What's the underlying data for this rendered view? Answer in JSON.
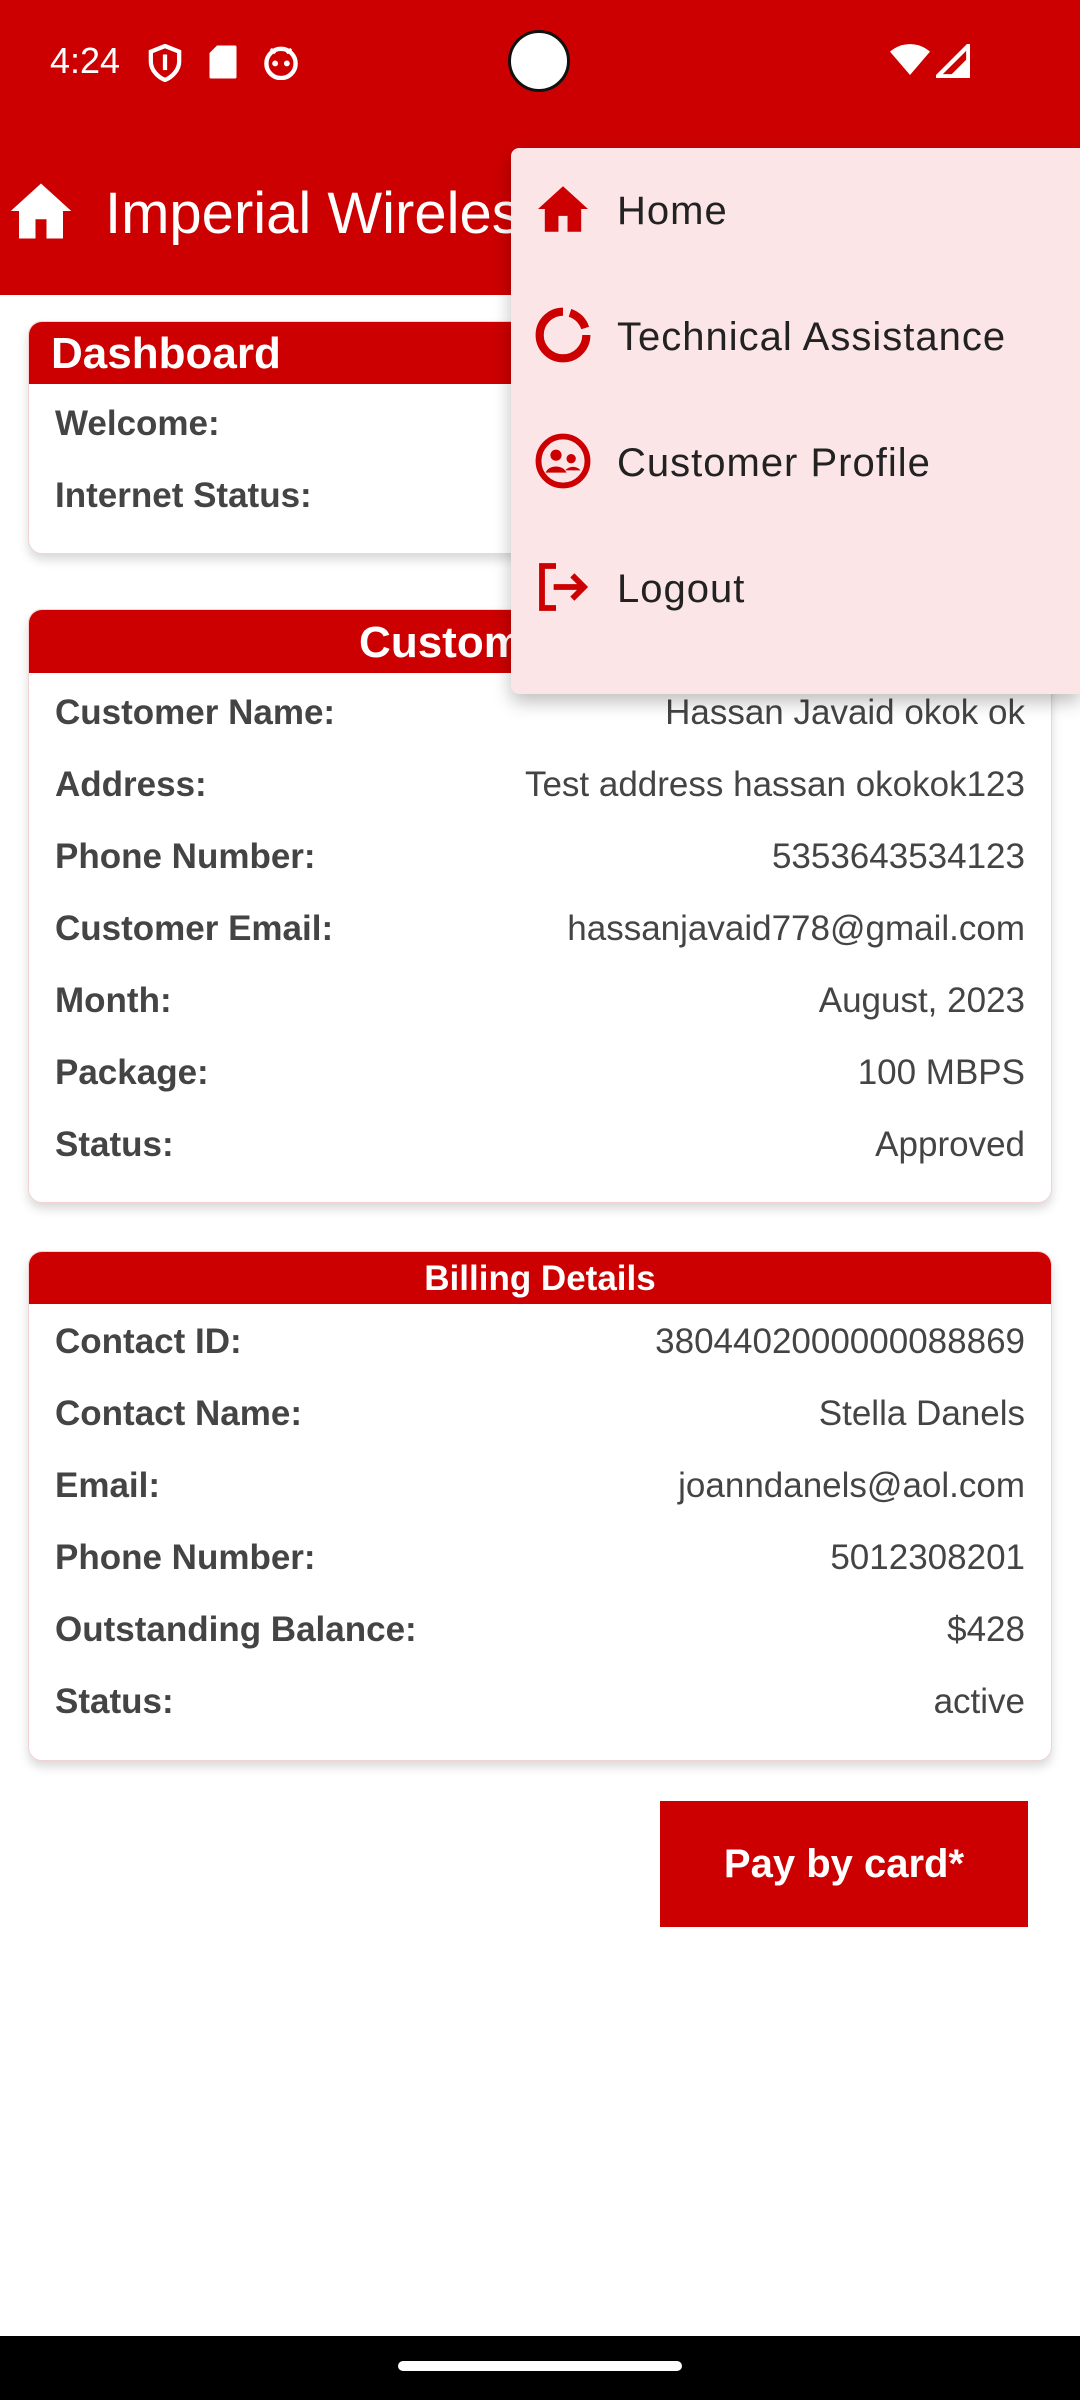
{
  "status_bar": {
    "time": "4:24"
  },
  "app_bar": {
    "title": "Imperial Wireless"
  },
  "dashboard": {
    "title": "Dashboard",
    "rows": [
      {
        "label": "Welcome:",
        "value": ""
      },
      {
        "label": "Internet Status:",
        "value": ""
      }
    ]
  },
  "customer": {
    "title": "Customer Details",
    "rows": [
      {
        "label": "Customer Name:",
        "value": "Hassan Javaid  okok ok"
      },
      {
        "label": "Address:",
        "value": "Test address hassan okokok123"
      },
      {
        "label": "Phone Number:",
        "value": "5353643534123"
      },
      {
        "label": "Customer Email:",
        "value": "hassanjavaid778@gmail.com"
      },
      {
        "label": "Month:",
        "value": "August, 2023"
      },
      {
        "label": "Package:",
        "value": "100 MBPS"
      },
      {
        "label": "Status:",
        "value": "Approved"
      }
    ]
  },
  "billing": {
    "title": "Billing Details",
    "rows": [
      {
        "label": "Contact ID:",
        "value": "3804402000000088869"
      },
      {
        "label": "Contact Name:",
        "value": "Stella Danels"
      },
      {
        "label": "Email:",
        "value": "joanndanels@aol.com"
      },
      {
        "label": "Phone Number:",
        "value": "5012308201"
      },
      {
        "label": "Outstanding Balance:",
        "value": "$428"
      },
      {
        "label": "Status:",
        "value": "active"
      }
    ]
  },
  "pay_button": {
    "label": "Pay by card*"
  },
  "menu": {
    "items": [
      {
        "label": "Home",
        "icon": "home-icon"
      },
      {
        "label": "Technical Assistance",
        "icon": "support-icon"
      },
      {
        "label": "Customer Profile",
        "icon": "profile-icon"
      },
      {
        "label": "Logout",
        "icon": "logout-icon"
      }
    ]
  },
  "colors": {
    "primary": "#cc0000",
    "menu_bg": "#fbe5e7"
  }
}
